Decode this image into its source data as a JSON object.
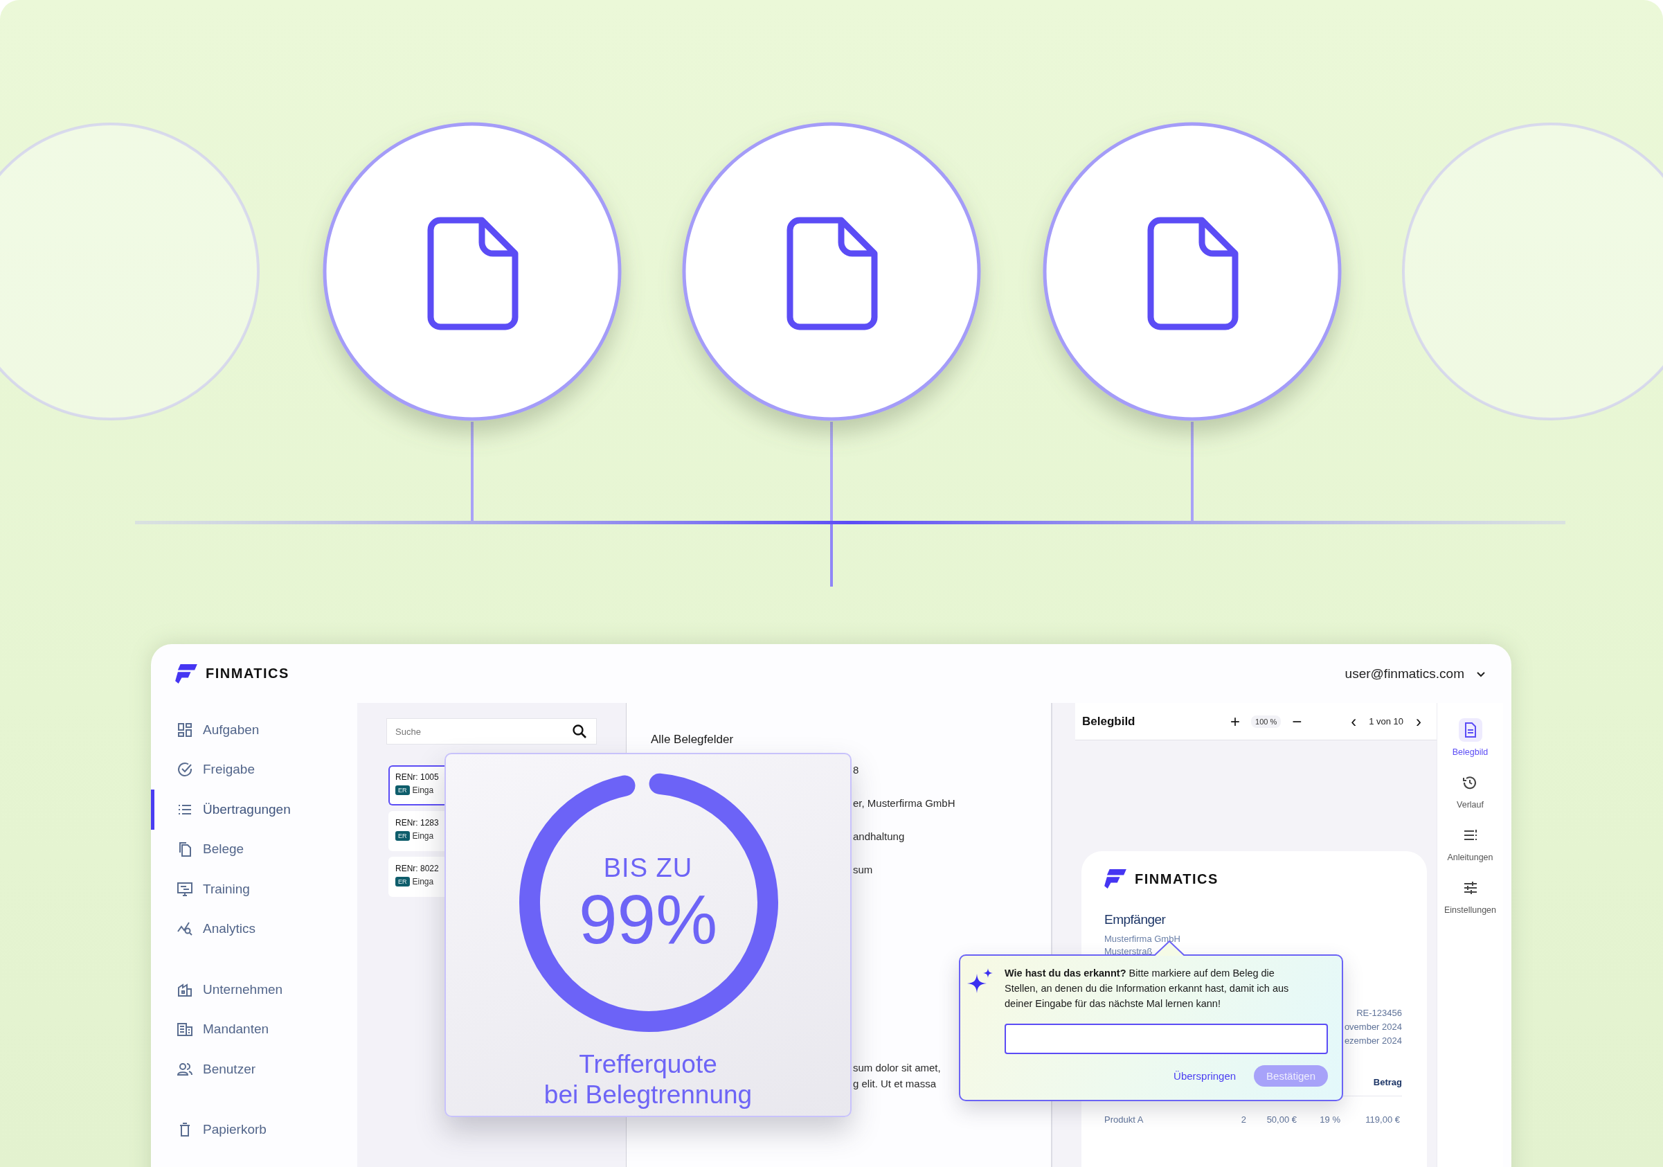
{
  "diagram": {
    "nodes": [
      {
        "kind": "faded"
      },
      {
        "kind": "document"
      },
      {
        "kind": "document"
      },
      {
        "kind": "document"
      },
      {
        "kind": "faded"
      }
    ]
  },
  "app": {
    "brand": "FINMATICS",
    "user": "user@finmatics.com",
    "sidebar": {
      "groups": [
        [
          {
            "label": "Aufgaben",
            "selected": false
          },
          {
            "label": "Freigabe",
            "selected": false
          },
          {
            "label": "Übertragungen",
            "selected": true
          },
          {
            "label": "Belege",
            "selected": false
          },
          {
            "label": "Training",
            "selected": false
          },
          {
            "label": "Analytics",
            "selected": false
          }
        ],
        [
          {
            "label": "Unternehmen",
            "selected": false
          },
          {
            "label": "Mandanten",
            "selected": false
          },
          {
            "label": "Benutzer",
            "selected": false
          }
        ],
        [
          {
            "label": "Papierkorb",
            "selected": false
          }
        ]
      ]
    },
    "list": {
      "search": {
        "placeholder": "Suche"
      },
      "cards": [
        {
          "number": "RENr: 1005",
          "tag": "ER",
          "status": "Einga",
          "selected": true
        },
        {
          "number": "RENr: 1283",
          "tag": "ER",
          "status": "Einga",
          "selected": false
        },
        {
          "number": "RENr: 8022",
          "tag": "ER",
          "status": "Einga",
          "selected": false
        }
      ]
    },
    "fields": {
      "title": "Alle Belegfelder",
      "values": [
        "8",
        "er, Musterfirma GmbH",
        "andhaltung",
        "sum"
      ],
      "notes": [
        "sum dolor sit amet,",
        "g elit. Ut et massa"
      ]
    },
    "viewer": {
      "title": "Belegbild",
      "zoom_in": "+",
      "zoom": "100 %",
      "zoom_out": "−",
      "prev": "‹",
      "page": "1 von 10",
      "next": "›",
      "document": {
        "brand": "FINMATICS",
        "heading": "Empfänger",
        "address": [
          "Musterfirma GmbH",
          "Musterstraß"
        ],
        "meta": [
          "RE-123456",
          "ovember 2024",
          "ezember 2024"
        ],
        "column": "Betrag",
        "row": [
          "Produkt A",
          "2",
          "50,00 €",
          "19 %",
          "119,00 €"
        ]
      }
    },
    "rail": [
      {
        "label": "Belegbild",
        "selected": true
      },
      {
        "label": "Verlauf",
        "selected": false
      },
      {
        "label": "Anleitungen",
        "selected": false
      },
      {
        "label": "Einstellungen",
        "selected": false
      }
    ],
    "stat": {
      "prefix": "BIS ZU",
      "value": "99%",
      "level": 0.99,
      "caption": [
        "Trefferquote",
        "bei Belegtrennung"
      ]
    },
    "prompt": {
      "text": "**Wie hast du das erkannt?** Bitte markiere auf dem Beleg die Stellen, an denen du die Information erkannt hast, damit ich aus deiner Eingabe für das nächste Mal lernen kann!",
      "skip": "Überspringen",
      "confirm": "Bestätigen",
      "confirm_disabled": true
    }
  }
}
